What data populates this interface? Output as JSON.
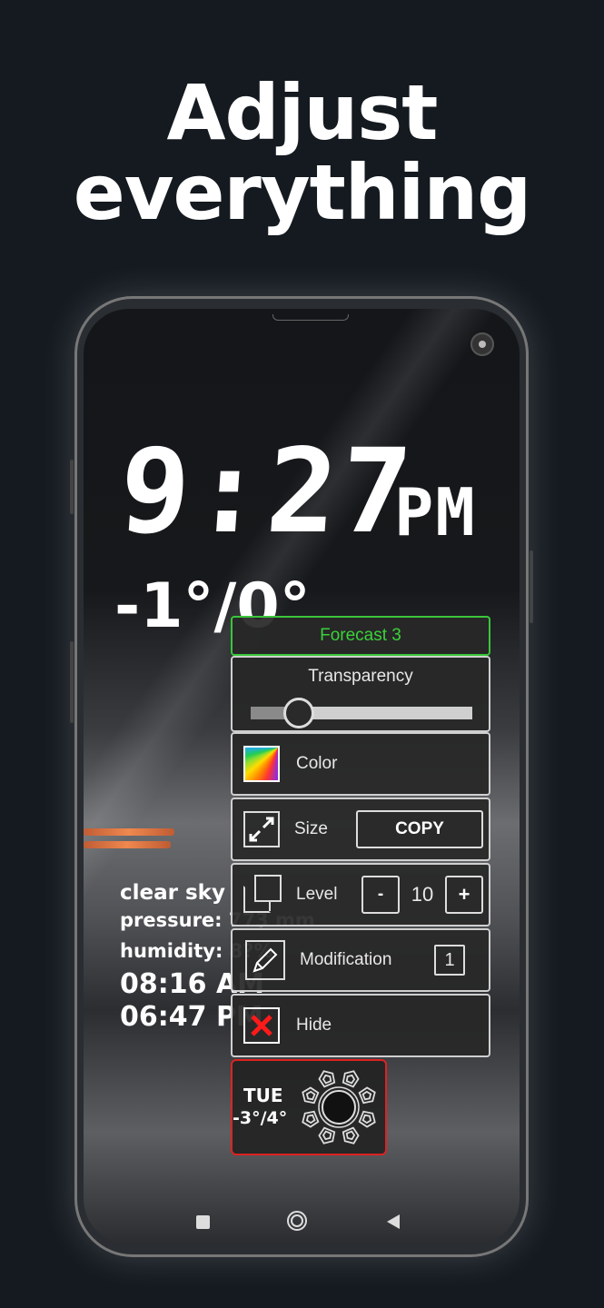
{
  "headline": {
    "line1": "Adjust",
    "line2": "everything"
  },
  "clock": {
    "time": "9:27",
    "ampm": "PM"
  },
  "temperature": "-1°/0°",
  "weather": {
    "condition": "clear sky",
    "pressure": "pressure: 773 mm",
    "humidity": "humidity: 8?%",
    "sunrise": "08:16 AM",
    "sunset": "06:47 PM"
  },
  "menu": {
    "title": "Forecast 3",
    "transparency_label": "Transparency",
    "transparency_value": 0.17,
    "color_label": "Color",
    "size_label": "Size",
    "copy_label": "COPY",
    "level_label": "Level",
    "level_minus": "-",
    "level_value": "10",
    "level_plus": "+",
    "modification_label": "Modification",
    "modification_value": "1",
    "hide_label": "Hide"
  },
  "forecast_card": {
    "day": "TUE",
    "temps": "-3°/4°",
    "icon": "sun-icon"
  },
  "accent_colors": {
    "title_border": "#3ac63a",
    "forecast_border": "#dd2222",
    "hide_x": "#ff1a1a"
  }
}
